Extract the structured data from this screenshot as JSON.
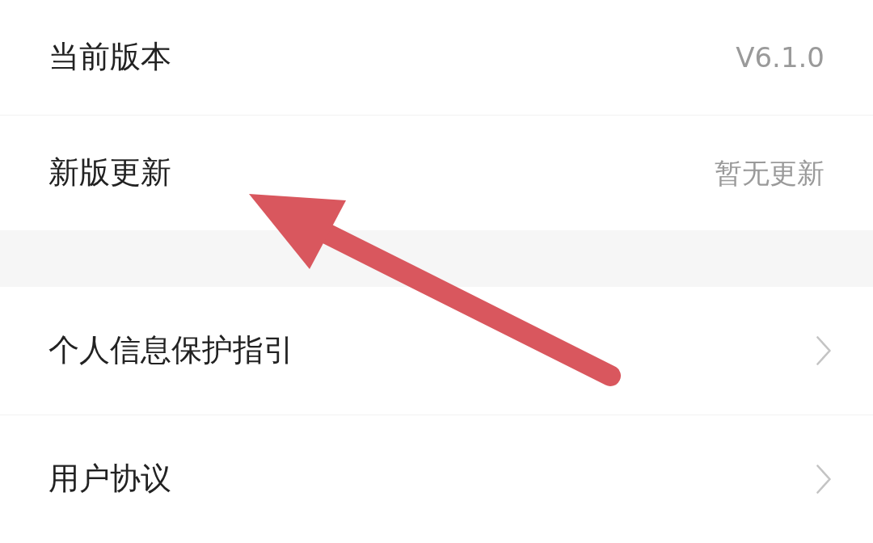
{
  "sections": [
    {
      "rows": [
        {
          "kind": "value",
          "label": "当前版本",
          "value": "V6.1.0"
        },
        {
          "kind": "value",
          "label": "新版更新",
          "value": "暂无更新"
        }
      ]
    },
    {
      "rows": [
        {
          "kind": "link",
          "label": "个人信息保护指引"
        },
        {
          "kind": "link",
          "label": "用户协议"
        }
      ]
    }
  ],
  "overlay": {
    "kind": "arrow"
  }
}
